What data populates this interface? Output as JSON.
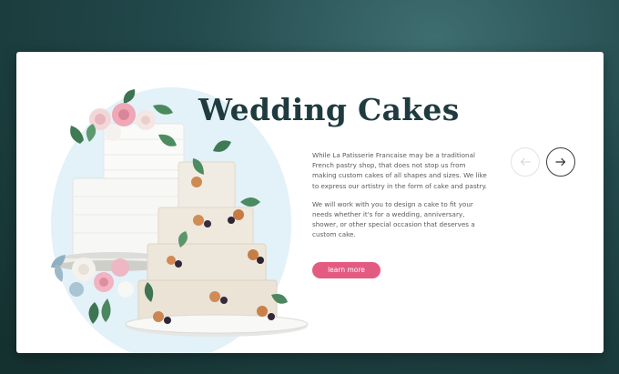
{
  "hero": {
    "title": "Wedding Cakes",
    "paragraph_1": "While La Patisserie Francaise may be a traditional French pastry shop, that does not stop us from making custom cakes of all shapes and sizes. We like to express our artistry in the form of cake and pastry.",
    "paragraph_2": "We will work with you to design a cake to fit your needs whether it's for a wedding, anniversary, shower, or other special occasion that deserves a custom cake.",
    "cta_label": "learn more"
  },
  "carousel": {
    "prev_icon": "arrow-left-icon",
    "next_icon": "arrow-right-icon"
  },
  "image": {
    "subject": "cake-illustration"
  },
  "colors": {
    "background": "#234a4d",
    "card": "#ffffff",
    "title": "#1f3b3f",
    "accent": "#e45b82",
    "text": "#5b5b5b"
  }
}
